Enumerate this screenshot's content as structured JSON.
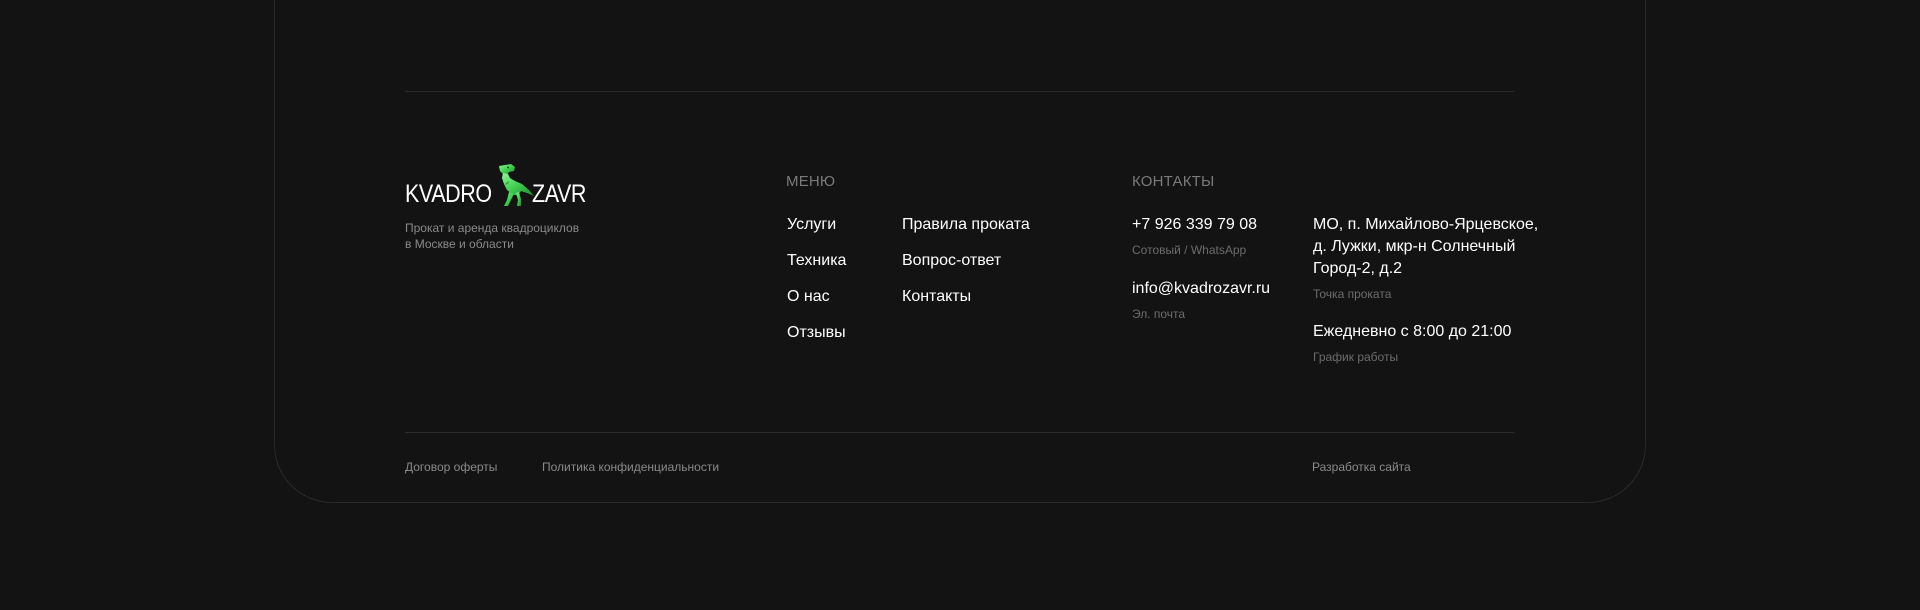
{
  "brand": {
    "name_left": "KVADRO",
    "name_right": "ZAVR",
    "tagline_line1": "Прокат и аренда квадроциклов",
    "tagline_line2": "в Москве и области",
    "accent_color": "#3fcf4f",
    "logo_icon": "dinosaur-icon"
  },
  "menu": {
    "title": "МЕНЮ",
    "col1": [
      "Услуги",
      "Техника",
      "О нас",
      "Отзывы"
    ],
    "col2": [
      "Правила проката",
      "Вопрос-ответ",
      "Контакты"
    ]
  },
  "contacts": {
    "title": "КОНТАКТЫ",
    "phone": "+7 926 339 79 08",
    "phone_note": "Сотовый / WhatsApp",
    "email": "info@kvadrozavr.ru",
    "email_note": "Эл. почта",
    "address_line1": "МО, п. Михайлово-Ярцевское,",
    "address_line2": "д. Лужки, мкр-н Солнечный",
    "address_line3": "Город-2, д.2",
    "address_note": "Точка проката",
    "hours": "Ежедневно с 8:00 до 21:00",
    "hours_note": "График работы"
  },
  "bottom": {
    "offer": "Договор оферты",
    "privacy": "Политика конфиденциальности",
    "dev": "Разработка сайта"
  }
}
